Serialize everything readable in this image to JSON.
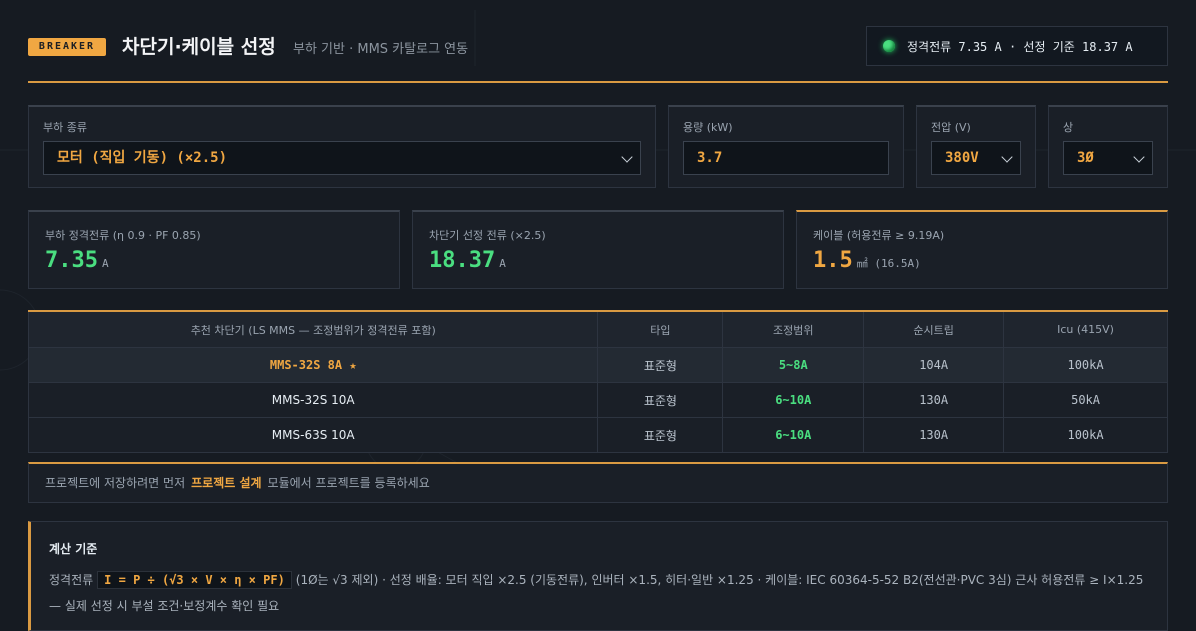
{
  "header": {
    "badge": "BREAKER",
    "title": "차단기·케이블 선정",
    "subtitle": "부하 기반 · MMS 카탈로그 연동",
    "status": "정격전류 7.35 A · 선정 기준 18.37 A"
  },
  "inputs": {
    "load_type": {
      "label": "부하 종류",
      "value": "모터 (직입 기동) (×2.5)"
    },
    "capacity": {
      "label": "용량 (kW)",
      "value": "3.7"
    },
    "voltage": {
      "label": "전압 (V)",
      "value": "380V"
    },
    "phase": {
      "label": "상",
      "value": "3Ø"
    }
  },
  "metrics": [
    {
      "label": "부하 정격전류 (η 0.9 · PF 0.85)",
      "value": "7.35",
      "unit": "A"
    },
    {
      "label": "차단기 선정 전류 (×2.5)",
      "value": "18.37",
      "unit": "A"
    },
    {
      "label": "케이블 (허용전류 ≥ 9.19A)",
      "value": "1.5",
      "unit": "㎟ (16.5A)"
    }
  ],
  "table": {
    "headers": [
      "추천 차단기 (LS MMS — 조정범위가 정격전류 포함)",
      "타입",
      "조정범위",
      "순시트립",
      "Icu (415V)"
    ],
    "rows": [
      {
        "name": "MMS-32S 8A ★",
        "type": "표준형",
        "range": "5~8A",
        "trip": "104A",
        "icu": "100kA"
      },
      {
        "name": "MMS-32S 10A",
        "type": "표준형",
        "range": "6~10A",
        "trip": "130A",
        "icu": "50kA"
      },
      {
        "name": "MMS-63S 10A",
        "type": "표준형",
        "range": "6~10A",
        "trip": "130A",
        "icu": "100kA"
      }
    ]
  },
  "notice": {
    "before": "프로젝트에 저장하려면 먼저",
    "link": "프로젝트 설계",
    "after": "모듈에서 프로젝트를 등록하세요"
  },
  "calc": {
    "title": "계산 기준",
    "prefix": "정격전류",
    "formula": "I = P ÷ (√3 × V × η × PF)",
    "rest": "(1Ø는 √3 제외) · 선정 배율: 모터 직입 ×2.5 (기동전류), 인버터 ×1.5, 히터·일반 ×1.25 · 케이블: IEC 60364-5-52 B2(전선관·PVC 3심) 근사 허용전류 ≥ I×1.25 — 실제 선정 시 부설 조건·보정계수 확인 필요"
  },
  "colors": {
    "accent": "#f0a742",
    "good": "#4ade80",
    "bg": "#161b22"
  }
}
